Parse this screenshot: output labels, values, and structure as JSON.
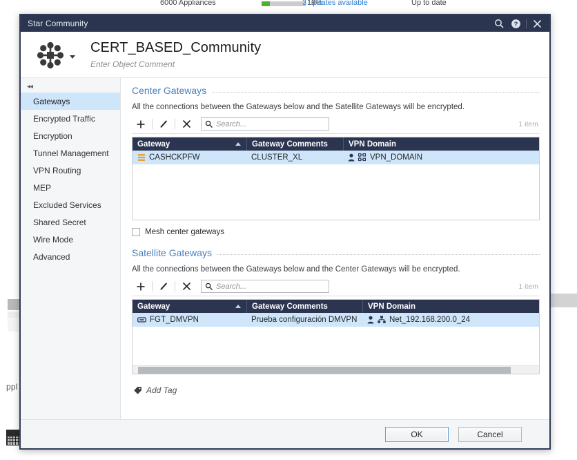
{
  "background": {
    "appliances_label": "6000 Appliances",
    "progress_pct": "19%",
    "updates_link": "3 updates available",
    "status_text": "Up to date",
    "partial_text": "ppl"
  },
  "window": {
    "title": "Star Community",
    "titlebar_icons": [
      "search-icon",
      "help-icon",
      "close-icon"
    ]
  },
  "header": {
    "object_icon": "star-community-icon",
    "title": "CERT_BASED_Community",
    "comment_placeholder": "Enter Object Comment"
  },
  "sidebar": {
    "collapse_icon": "collapse-left-icon",
    "items": [
      {
        "label": "Gateways",
        "active": true
      },
      {
        "label": "Encrypted Traffic",
        "active": false
      },
      {
        "label": "Encryption",
        "active": false
      },
      {
        "label": "Tunnel Management",
        "active": false
      },
      {
        "label": "VPN Routing",
        "active": false
      },
      {
        "label": "MEP",
        "active": false
      },
      {
        "label": "Excluded Services",
        "active": false
      },
      {
        "label": "Shared Secret",
        "active": false
      },
      {
        "label": "Wire Mode",
        "active": false
      },
      {
        "label": "Advanced",
        "active": false
      }
    ]
  },
  "center_gateways": {
    "section_title": "Center Gateways",
    "description": "All the connections between the Gateways below and the Satellite Gateways will be encrypted.",
    "toolbar": {
      "add_label": "+",
      "edit_label": "edit-pencil-icon",
      "delete_label": "✕",
      "search_placeholder": "Search..."
    },
    "item_count": "1 item",
    "columns": [
      "Gateway",
      "Gateway Comments",
      "VPN Domain"
    ],
    "rows": [
      {
        "gateway": "CASHCKPFW",
        "gateway_icon": "cluster-gateway-icon",
        "comments": "CLUSTER_XL",
        "vpn_domain": "VPN_DOMAIN",
        "domain_icons": [
          "user-icon",
          "network-grid-icon"
        ],
        "selected": true
      }
    ],
    "mesh_checkbox_label": "Mesh center gateways",
    "mesh_checked": false
  },
  "satellite_gateways": {
    "section_title": "Satellite Gateways",
    "description": "All the connections between the Gateways below and the Center Gateways will be encrypted.",
    "toolbar": {
      "add_label": "+",
      "edit_label": "edit-pencil-icon",
      "delete_label": "✕",
      "search_placeholder": "Search..."
    },
    "item_count": "1 item",
    "columns": [
      "Gateway",
      "Gateway Comments",
      "VPN Domain"
    ],
    "rows": [
      {
        "gateway": "FGT_DMVPN",
        "gateway_icon": "interop-device-icon",
        "comments": "Prueba configuración DMVPN",
        "vpn_domain": "Net_192.168.200.0_24",
        "domain_icons": [
          "user-icon",
          "network-tree-icon"
        ],
        "selected": true
      }
    ]
  },
  "tags": {
    "add_tag_label": "Add Tag",
    "tag_icon": "tag-icon"
  },
  "footer": {
    "ok_label": "OK",
    "cancel_label": "Cancel"
  },
  "colors": {
    "titlebar": "#2b3550",
    "accent_link": "#4a7fbd",
    "selection": "#cfe5fa",
    "grid_header": "#2b3550",
    "cluster_icon": "#e8a33d"
  }
}
